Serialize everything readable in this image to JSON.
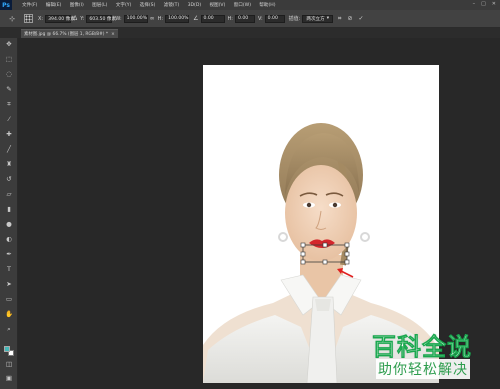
{
  "app": {
    "logo": "Ps"
  },
  "menu": [
    "文件(F)",
    "编辑(E)",
    "图像(I)",
    "图层(L)",
    "文字(Y)",
    "选择(S)",
    "滤镜(T)",
    "3D(D)",
    "视图(V)",
    "窗口(W)",
    "帮助(H)"
  ],
  "options": {
    "x_label": "X:",
    "x_value": "394.00 像素",
    "y_label": "Y:",
    "y_value": "603.50 像素",
    "w_label": "W:",
    "w_value": "100.00%",
    "h_label": "H:",
    "h_value": "100.00%",
    "angle_value": "0.00",
    "hskew_label": "H:",
    "hskew_value": "0.00",
    "vskew_label": "V:",
    "vskew_value": "0.00",
    "interp_label": "插值:",
    "interp_value": "两次立方"
  },
  "document": {
    "tab_title": "素材图.jpg @ 66.7% (图层 1, RGB/8#) *"
  },
  "colors": {
    "foreground": "#43b7b7",
    "background": "#ffffff",
    "accent": "#31a8ff"
  },
  "tools": [
    "move-icon",
    "marquee-icon",
    "lasso-icon",
    "quick-select-icon",
    "crop-icon",
    "eyedropper-icon",
    "healing-icon",
    "brush-icon",
    "stamp-icon",
    "history-brush-icon",
    "eraser-icon",
    "gradient-icon",
    "blur-icon",
    "dodge-icon",
    "pen-icon",
    "type-icon",
    "path-select-icon",
    "rectangle-icon",
    "hand-icon",
    "zoom-icon"
  ],
  "watermark": {
    "title": "百科全说",
    "subtitle": "助你轻松解决"
  }
}
